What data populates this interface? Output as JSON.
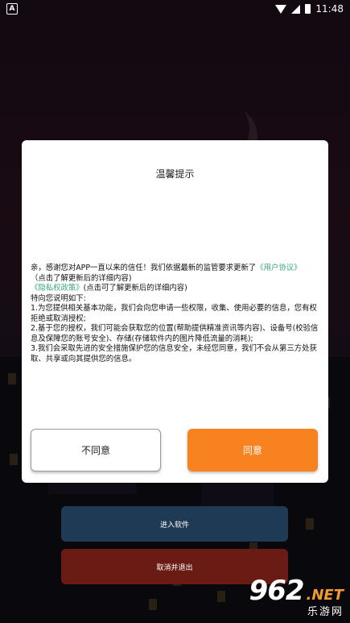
{
  "status_bar": {
    "app_icon_letter": "A",
    "time": "11:48"
  },
  "background": {
    "enter_button_label": "进入软件",
    "cancel_button_label": "取消并退出"
  },
  "dialog": {
    "title": "温馨提示",
    "intro_prefix": "亲，感谢您对APP一直以来的信任！我们依据最新的监管要求更新了",
    "user_agreement_link": "《用户协议》",
    "user_agreement_note": "（点击了解更新后的详细内容)",
    "privacy_policy_link": "《隐私权政策》",
    "privacy_policy_note": "(点击可了解更新后的详细内容)",
    "explain_heading": "特向您说明如下:",
    "point_1": "1.为您提供相关基本功能，我们会向您申请一些权限，收集、使用必要的信息，您有权拒绝或取消授权;",
    "point_2": "2.基于您的授权，我们可能会获取您的位置(帮助提供精准资讯等内容)、设备号(校验信息及保障您的账号安全)、存储(存储软件内的图片降低流量的消耗);",
    "point_3": "3.我们会采取先进的安全措施保护您的信息安全，未经您同意，我们不会从第三方处获取、共享或向其提供您的信息。",
    "disagree_label": "不同意",
    "agree_label": "同意"
  },
  "watermark": {
    "number": "962",
    "net": ".NET",
    "subtitle": "乐游网"
  },
  "colors": {
    "accent_orange": "#f7821f",
    "link_green": "#3aa87a"
  }
}
